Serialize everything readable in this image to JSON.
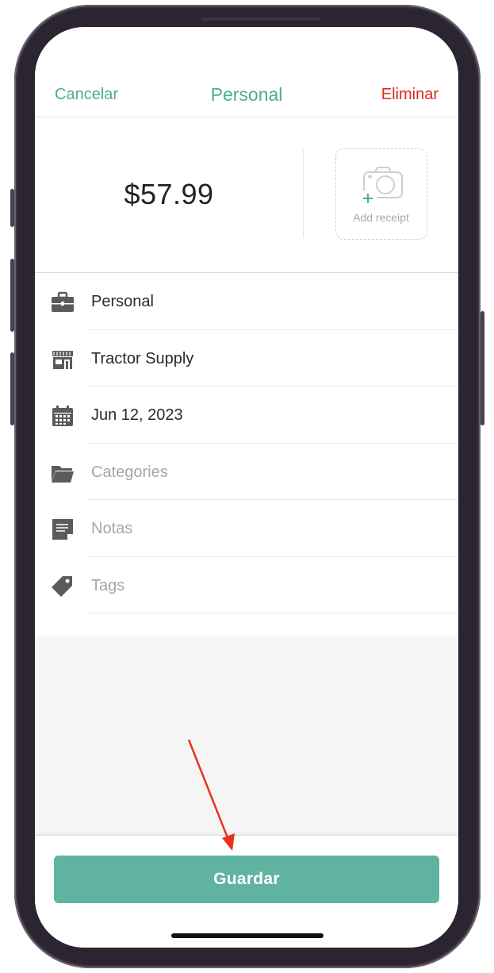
{
  "nav": {
    "cancel_label": "Cancelar",
    "title": "Personal",
    "delete_label": "Eliminar"
  },
  "transaction": {
    "amount": "$57.99",
    "add_receipt_label": "Add receipt"
  },
  "rows": [
    {
      "icon": "briefcase-icon",
      "text": "Personal",
      "is_placeholder": false
    },
    {
      "icon": "store-icon",
      "text": "Tractor Supply",
      "is_placeholder": false
    },
    {
      "icon": "calendar-icon",
      "text": "Jun 12, 2023",
      "is_placeholder": false
    },
    {
      "icon": "folder-icon",
      "text": "Categories",
      "is_placeholder": true
    },
    {
      "icon": "note-icon",
      "text": "Notas",
      "is_placeholder": true
    },
    {
      "icon": "tag-icon",
      "text": "Tags",
      "is_placeholder": true
    }
  ],
  "footer": {
    "save_label": "Guardar"
  },
  "colors": {
    "accent": "#4faa97",
    "button": "#5fb3a0",
    "danger": "#e0291c",
    "annotation_arrow": "#e8321e"
  }
}
